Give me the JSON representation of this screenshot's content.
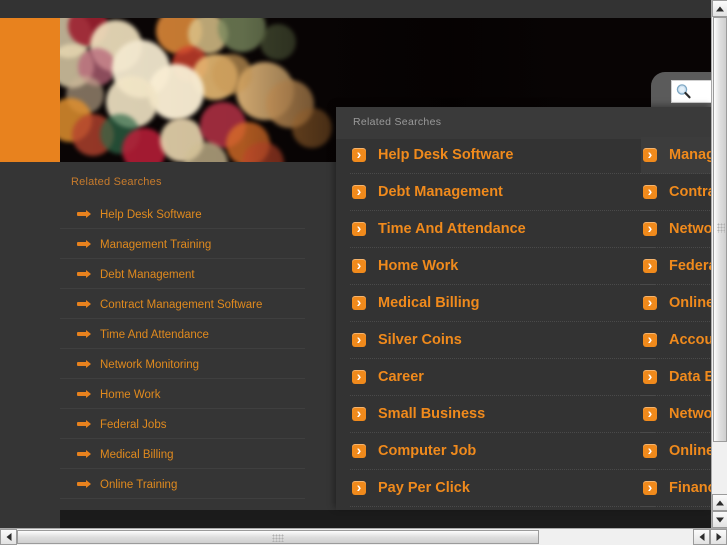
{
  "window": {
    "background_color": "#353535",
    "accent_color": "#e8821e",
    "header_strip_color": "#333333"
  },
  "banner": {
    "name": "bokeh-lights-banner",
    "orange_block_color": "#e8821e"
  },
  "search": {
    "placeholder": "",
    "value": "",
    "icon": "search-icon"
  },
  "sidebar": {
    "title": "Related Searches",
    "items": [
      {
        "label": "Help Desk Software"
      },
      {
        "label": "Management Training"
      },
      {
        "label": "Debt Management"
      },
      {
        "label": "Contract Management Software"
      },
      {
        "label": "Time And Attendance"
      },
      {
        "label": "Network Monitoring"
      },
      {
        "label": "Home Work"
      },
      {
        "label": "Federal Jobs"
      },
      {
        "label": "Medical Billing"
      },
      {
        "label": "Online Training"
      }
    ]
  },
  "overlay": {
    "title": "Related Searches",
    "left_column": [
      {
        "label": "Help Desk Software"
      },
      {
        "label": "Debt Management"
      },
      {
        "label": "Time And Attendance"
      },
      {
        "label": "Home Work"
      },
      {
        "label": "Medical Billing"
      },
      {
        "label": "Silver Coins"
      },
      {
        "label": "Career"
      },
      {
        "label": "Small Business"
      },
      {
        "label": "Computer Job"
      },
      {
        "label": "Pay Per Click"
      }
    ],
    "right_column": [
      {
        "label": "Management Training"
      },
      {
        "label": "Contract Management Software"
      },
      {
        "label": "Network Monitoring"
      },
      {
        "label": "Federal Jobs"
      },
      {
        "label": "Online Training"
      },
      {
        "label": "Accounting"
      },
      {
        "label": "Data Entry"
      },
      {
        "label": "Network Security"
      },
      {
        "label": "Online Degree"
      },
      {
        "label": "Finance"
      }
    ]
  },
  "scrollbars": {
    "vertical": {
      "up_label": "",
      "down_label": ""
    },
    "horizontal": {
      "left_label": "",
      "right_label": ""
    }
  }
}
